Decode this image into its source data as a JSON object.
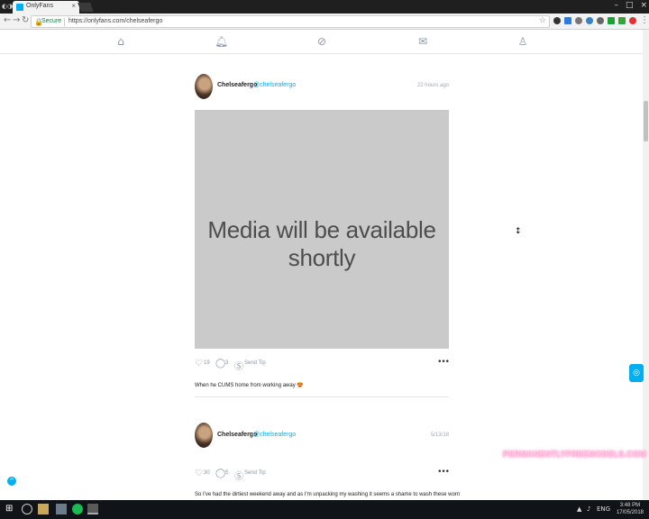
{
  "browser": {
    "tab_title": "OnlyFans",
    "tab_close": "×",
    "window_buttons": [
      "–",
      "□",
      "×"
    ],
    "secure_label": "Secure",
    "url": "https://onlyfans.com/chelseafergo",
    "back": "←",
    "forward": "→",
    "reload": "↻"
  },
  "posts": [
    {
      "name": "Chelseafergo",
      "handle": "@chelseafergo",
      "time": "22 hours ago",
      "media_text": "Media will be available shortly",
      "likes": "19",
      "comments": "3",
      "tip_label": "Send Tip",
      "text": "When he CUMS home from working away 😍"
    },
    {
      "name": "Chelseafergo",
      "handle": "@chelseafergo",
      "time": "5/13/18",
      "likes": "30",
      "comments": "5",
      "tip_label": "Send Tip",
      "text": "So I've had the dirtiest weekend away and as I'm unpacking my washing it seems a shame to wash these worn"
    }
  ],
  "watermark": "PERMANENTLYFREEMODELS.COM",
  "taskbar": {
    "language": "ENG",
    "time": "3:48 PM",
    "date": "17/05/2018"
  },
  "colors": {
    "accent": "#00aff0",
    "media_placeholder": "#cacaca"
  }
}
